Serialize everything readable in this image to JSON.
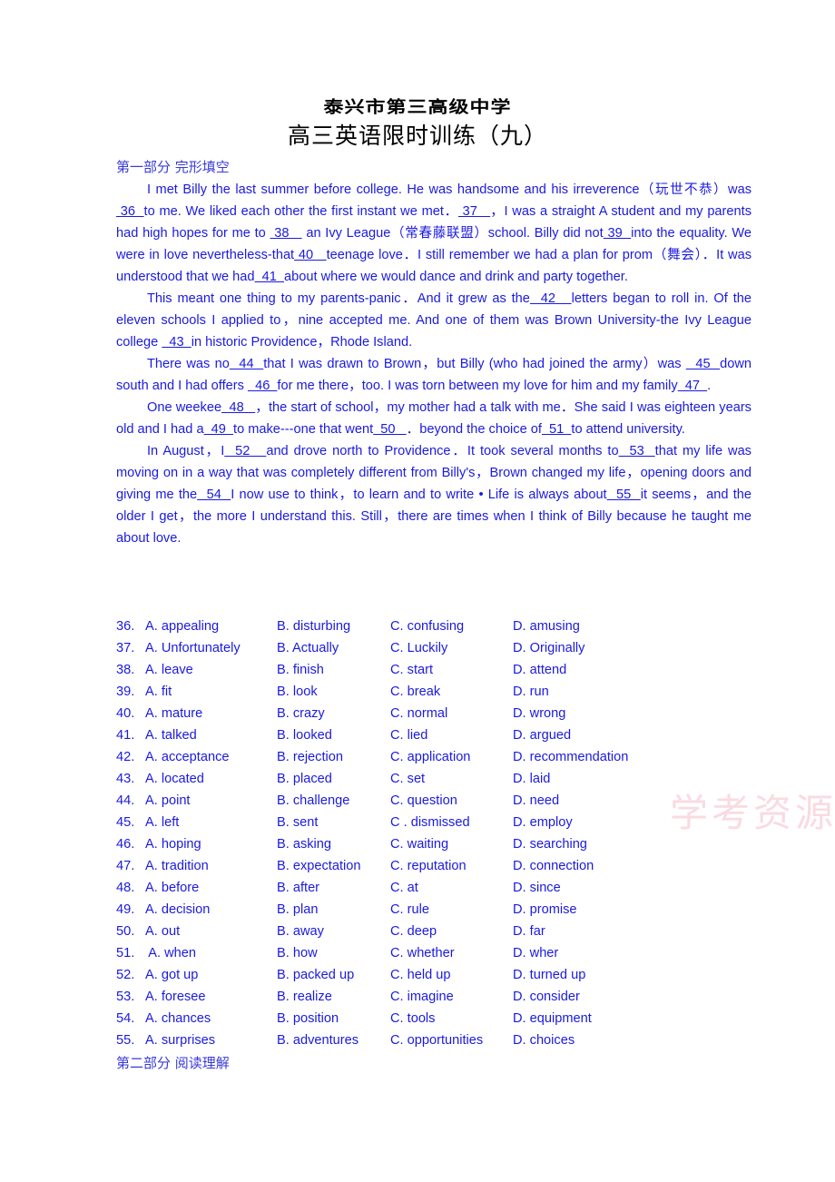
{
  "document": {
    "school_title": "泰兴市第三高级中学",
    "exam_title": "高三英语限时训练（九）",
    "watermark": "学考资源网"
  },
  "part_one": {
    "heading": "第一部分   完形填空",
    "paragraphs": [
      {
        "id": "passage-paragraph-1",
        "runs": [
          {
            "t": "indent"
          },
          {
            "t": "text",
            "v": "I met Billy the last summer before college. He was handsome and his irreverence（玩世不恭）was "
          },
          {
            "t": "blank",
            "v": " 36  "
          },
          {
            "t": "text",
            "v": "to me. We liked each other the first instant we met．"
          },
          {
            "t": "blank",
            "v": " 37   "
          },
          {
            "t": "text",
            "v": "，I was a straight A student and my parents had high hopes for me to "
          },
          {
            "t": "blank",
            "v": " 38   "
          },
          {
            "t": "text",
            "v": " an Ivy League（常春藤联盟）school. Billy did not"
          },
          {
            "t": "blank",
            "v": " 39  "
          },
          {
            "t": "text",
            "v": "into the equality. We were in love nevertheless-that"
          },
          {
            "t": "blank",
            "v": " 40   "
          },
          {
            "t": "text",
            "v": "teenage love．I still remember we had a plan for prom（舞会）．It was understood that we had"
          },
          {
            "t": "blank",
            "v": "  41  "
          },
          {
            "t": "text",
            "v": "about where we would dance and drink and party together."
          }
        ]
      },
      {
        "id": "passage-paragraph-2",
        "runs": [
          {
            "t": "indent"
          },
          {
            "t": "text",
            "v": "This meant one thing to my parents-panic．And it grew as the"
          },
          {
            "t": "blank",
            "v": "  42   "
          },
          {
            "t": "text",
            "v": "letters began to roll in. Of the eleven schools I applied to，nine accepted me. And one of them was Brown University-the Ivy League college "
          },
          {
            "t": "blank",
            "v": "  43  "
          },
          {
            "t": "text",
            "v": "in historic Providence，Rhode Island."
          }
        ]
      },
      {
        "id": "passage-paragraph-3",
        "runs": [
          {
            "t": "indent"
          },
          {
            "t": "text",
            "v": "There was no"
          },
          {
            "t": "blank",
            "v": "  44  "
          },
          {
            "t": "text",
            "v": "that I was drawn to Brown，but Billy (who had joined the army）was "
          },
          {
            "t": "blank",
            "v": "  45  "
          },
          {
            "t": "text",
            "v": "down south and I had offers "
          },
          {
            "t": "blank",
            "v": "  46  "
          },
          {
            "t": "text",
            "v": "for me there，too. I was torn between my love for him and my family"
          },
          {
            "t": "blank",
            "v": "  47  "
          },
          {
            "t": "text",
            "v": "."
          }
        ]
      },
      {
        "id": "passage-paragraph-4",
        "runs": [
          {
            "t": "indent"
          },
          {
            "t": "text",
            "v": "One weekee"
          },
          {
            "t": "blank",
            "v": "  48   "
          },
          {
            "t": "text",
            "v": "，the start of school，my mother had a talk with me．She said I was eighteen years old and I had a"
          },
          {
            "t": "blank",
            "v": "  49  "
          },
          {
            "t": "text",
            "v": "to make---one that went"
          },
          {
            "t": "blank",
            "v": "  50   "
          },
          {
            "t": "text",
            "v": "．beyond the choice of"
          },
          {
            "t": "blank",
            "v": "  51  "
          },
          {
            "t": "text",
            "v": "to attend university."
          }
        ]
      },
      {
        "id": "passage-paragraph-5",
        "runs": [
          {
            "t": "indent"
          },
          {
            "t": "text",
            "v": "In August，I"
          },
          {
            "t": "blank",
            "v": "  52   "
          },
          {
            "t": "text",
            "v": "and drove north to Providence．It took several months to"
          },
          {
            "t": "blank",
            "v": "  53  "
          },
          {
            "t": "text",
            "v": "that my life was moving on in a way that was completely different from Billy's，Brown changed my life，opening doors and giving me the"
          },
          {
            "t": "blank",
            "v": "  54  "
          },
          {
            "t": "text",
            "v": "I now use to think，to learn and to write • Life is always about"
          },
          {
            "t": "blank",
            "v": "  55  "
          },
          {
            "t": "text",
            "v": "it seems，and the older I get，the more I understand this. Still，there are times when I think of Billy because he taught me about love."
          }
        ]
      }
    ],
    "options": [
      {
        "num": "36.",
        "a": "A. appealing",
        "b": "B. disturbing",
        "c": "C. confusing",
        "d": "D. amusing"
      },
      {
        "num": "37.",
        "a": "A. Unfortunately",
        "b": "B. Actually",
        "c": "C. Luckily",
        "d": "D. Originally"
      },
      {
        "num": "38.",
        "a": "A. leave",
        "b": "B. finish",
        "c": "C. start",
        "d": "D. attend"
      },
      {
        "num": "39.",
        "a": "A. fit",
        "b": "B. look",
        "c": "C. break",
        "d": "D. run"
      },
      {
        "num": "40.",
        "a": "A. mature",
        "b": "B. crazy",
        "c": "C. normal",
        "d": "D. wrong"
      },
      {
        "num": "41.",
        "a": "A. talked",
        "b": "B. looked",
        "c": "C. lied",
        "d": "D. argued"
      },
      {
        "num": "42.",
        "a": "A. acceptance",
        "b": "B. rejection",
        "c": "C. application",
        "d": "D. recommendation"
      },
      {
        "num": "43.",
        "a": "A. located",
        "b": "B. placed",
        "c": "C. set",
        "d": "D. laid"
      },
      {
        "num": "44.",
        "a": "A. point",
        "b": "B. challenge",
        "c": "C. question",
        "d": "D. need"
      },
      {
        "num": "45.",
        "a": "A. left",
        "b": "B. sent",
        "c": "C . dismissed",
        "d": "D. employ"
      },
      {
        "num": "46.",
        "a": "A. hoping",
        "b": "B. asking",
        "c": "C. waiting",
        "d": "D. searching"
      },
      {
        "num": "47.",
        "a": "A. tradition",
        "b": "B. expectation",
        "c": "C. reputation",
        "d": "D. connection"
      },
      {
        "num": "48.",
        "a": "A. before",
        "b": "B. after",
        "c": "C. at",
        "d": "D. since"
      },
      {
        "num": "49.",
        "a": "A. decision",
        "b": "B. plan",
        "c": "C. rule",
        "d": "D. promise"
      },
      {
        "num": "50.",
        "a": "A. out",
        "b": "B. away",
        "c": "C. deep",
        "d": "D. far"
      },
      {
        "num": "51.",
        "a": " A. when",
        "b": "B. how",
        "c": "C. whether",
        "d": "D. wher"
      },
      {
        "num": "52.",
        "a": "A. got up",
        "b": "B. packed up",
        "c": "C. held up",
        "d": "D. turned up"
      },
      {
        "num": "53.",
        "a": "A. foresee",
        "b": "B. realize",
        "c": "C. imagine",
        "d": "D. consider"
      },
      {
        "num": "54.",
        "a": "A. chances",
        "b": "B. position",
        "c": "C. tools",
        "d": "D. equipment"
      },
      {
        "num": "55.",
        "a": "A. surprises",
        "b": "B. adventures",
        "c": "C. opportunities",
        "d": "D. choices"
      }
    ]
  },
  "part_two": {
    "heading": "第二部分  阅读理解"
  },
  "colors": {
    "body_text": "#1a1ae0",
    "heading_text": "#3a3ad8",
    "title_text": "#000000",
    "watermark": "#f7cfd8",
    "page_background": "#ffffff"
  }
}
